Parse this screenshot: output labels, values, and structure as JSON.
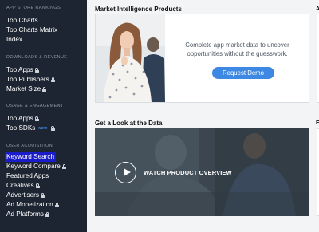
{
  "sidebar": {
    "sections": [
      {
        "title": "APP STORE RANKINGS",
        "items": [
          {
            "label": "Top Charts",
            "locked": false
          },
          {
            "label": "Top Charts Matrix",
            "locked": false
          },
          {
            "label": "Index",
            "locked": false
          }
        ]
      },
      {
        "title": "DOWNLOADS & REVENUE",
        "items": [
          {
            "label": "Top Apps",
            "locked": true
          },
          {
            "label": "Top Publishers",
            "locked": true
          },
          {
            "label": "Market Size",
            "locked": true
          }
        ]
      },
      {
        "title": "USAGE & ENGAGEMENT",
        "items": [
          {
            "label": "Top Apps",
            "locked": true
          },
          {
            "label": "Top SDKs",
            "locked": true,
            "badge": "NEW"
          }
        ]
      },
      {
        "title": "USER ACQUISITION",
        "items": [
          {
            "label": "Keyword Search",
            "locked": false,
            "active": true
          },
          {
            "label": "Keyword Compare",
            "locked": true
          },
          {
            "label": "Featured Apps",
            "locked": false
          },
          {
            "label": "Creatives",
            "locked": true
          },
          {
            "label": "Advertisers",
            "locked": true
          },
          {
            "label": "Ad Monetization",
            "locked": true
          },
          {
            "label": "Ad Platforms",
            "locked": true
          }
        ]
      }
    ]
  },
  "main": {
    "promo": {
      "heading": "Market Intelligence Products",
      "text": "Complete app market data to uncover opportunities without the guesswork.",
      "button_label": "Request Demo"
    },
    "video": {
      "heading": "Get a Look at the Data",
      "label": "WATCH PRODUCT OVERVIEW"
    },
    "cutoff": {
      "heading_1": "A",
      "heading_2": "E"
    }
  },
  "colors": {
    "sidebar_bg": "#1d2532",
    "accent": "#3d88e2",
    "active_highlight": "#1a1cc9",
    "new_badge": "#3d8ff0"
  }
}
